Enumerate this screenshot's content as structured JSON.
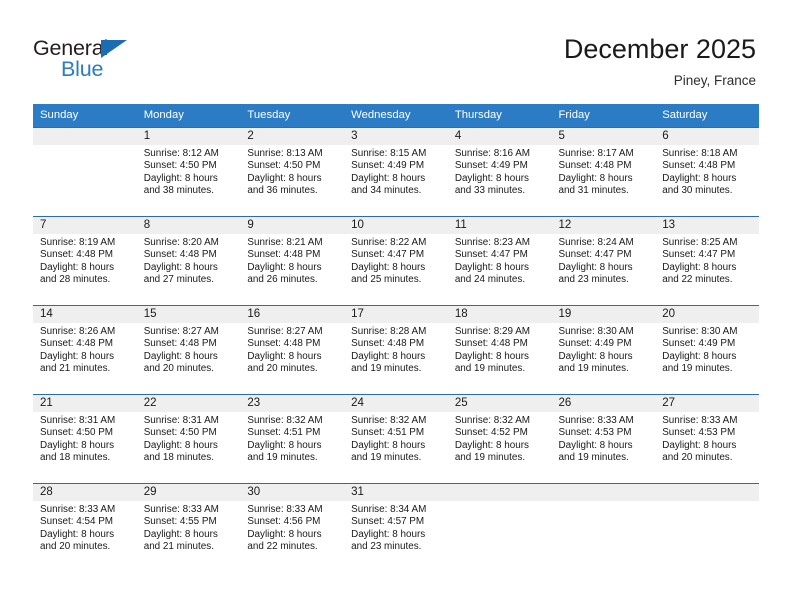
{
  "brand": {
    "name_part1": "General",
    "name_part2": "Blue",
    "triangle_icon": "triangle-icon",
    "accent_color": "#2b7cc4",
    "dark_color": "#231f20"
  },
  "header": {
    "month_title": "December 2025",
    "location": "Piney, France"
  },
  "calendar": {
    "header_bg": "#2b7cc4",
    "daynum_bg": "#efefef",
    "row_divider": "#2b6cb0",
    "weekdays": [
      "Sunday",
      "Monday",
      "Tuesday",
      "Wednesday",
      "Thursday",
      "Friday",
      "Saturday"
    ],
    "weeks": [
      [
        {
          "day": "",
          "lines": []
        },
        {
          "day": "1",
          "lines": [
            "Sunrise: 8:12 AM",
            "Sunset: 4:50 PM",
            "Daylight: 8 hours",
            "and 38 minutes."
          ]
        },
        {
          "day": "2",
          "lines": [
            "Sunrise: 8:13 AM",
            "Sunset: 4:50 PM",
            "Daylight: 8 hours",
            "and 36 minutes."
          ]
        },
        {
          "day": "3",
          "lines": [
            "Sunrise: 8:15 AM",
            "Sunset: 4:49 PM",
            "Daylight: 8 hours",
            "and 34 minutes."
          ]
        },
        {
          "day": "4",
          "lines": [
            "Sunrise: 8:16 AM",
            "Sunset: 4:49 PM",
            "Daylight: 8 hours",
            "and 33 minutes."
          ]
        },
        {
          "day": "5",
          "lines": [
            "Sunrise: 8:17 AM",
            "Sunset: 4:48 PM",
            "Daylight: 8 hours",
            "and 31 minutes."
          ]
        },
        {
          "day": "6",
          "lines": [
            "Sunrise: 8:18 AM",
            "Sunset: 4:48 PM",
            "Daylight: 8 hours",
            "and 30 minutes."
          ]
        }
      ],
      [
        {
          "day": "7",
          "lines": [
            "Sunrise: 8:19 AM",
            "Sunset: 4:48 PM",
            "Daylight: 8 hours",
            "and 28 minutes."
          ]
        },
        {
          "day": "8",
          "lines": [
            "Sunrise: 8:20 AM",
            "Sunset: 4:48 PM",
            "Daylight: 8 hours",
            "and 27 minutes."
          ]
        },
        {
          "day": "9",
          "lines": [
            "Sunrise: 8:21 AM",
            "Sunset: 4:48 PM",
            "Daylight: 8 hours",
            "and 26 minutes."
          ]
        },
        {
          "day": "10",
          "lines": [
            "Sunrise: 8:22 AM",
            "Sunset: 4:47 PM",
            "Daylight: 8 hours",
            "and 25 minutes."
          ]
        },
        {
          "day": "11",
          "lines": [
            "Sunrise: 8:23 AM",
            "Sunset: 4:47 PM",
            "Daylight: 8 hours",
            "and 24 minutes."
          ]
        },
        {
          "day": "12",
          "lines": [
            "Sunrise: 8:24 AM",
            "Sunset: 4:47 PM",
            "Daylight: 8 hours",
            "and 23 minutes."
          ]
        },
        {
          "day": "13",
          "lines": [
            "Sunrise: 8:25 AM",
            "Sunset: 4:47 PM",
            "Daylight: 8 hours",
            "and 22 minutes."
          ]
        }
      ],
      [
        {
          "day": "14",
          "lines": [
            "Sunrise: 8:26 AM",
            "Sunset: 4:48 PM",
            "Daylight: 8 hours",
            "and 21 minutes."
          ]
        },
        {
          "day": "15",
          "lines": [
            "Sunrise: 8:27 AM",
            "Sunset: 4:48 PM",
            "Daylight: 8 hours",
            "and 20 minutes."
          ]
        },
        {
          "day": "16",
          "lines": [
            "Sunrise: 8:27 AM",
            "Sunset: 4:48 PM",
            "Daylight: 8 hours",
            "and 20 minutes."
          ]
        },
        {
          "day": "17",
          "lines": [
            "Sunrise: 8:28 AM",
            "Sunset: 4:48 PM",
            "Daylight: 8 hours",
            "and 19 minutes."
          ]
        },
        {
          "day": "18",
          "lines": [
            "Sunrise: 8:29 AM",
            "Sunset: 4:48 PM",
            "Daylight: 8 hours",
            "and 19 minutes."
          ]
        },
        {
          "day": "19",
          "lines": [
            "Sunrise: 8:30 AM",
            "Sunset: 4:49 PM",
            "Daylight: 8 hours",
            "and 19 minutes."
          ]
        },
        {
          "day": "20",
          "lines": [
            "Sunrise: 8:30 AM",
            "Sunset: 4:49 PM",
            "Daylight: 8 hours",
            "and 19 minutes."
          ]
        }
      ],
      [
        {
          "day": "21",
          "lines": [
            "Sunrise: 8:31 AM",
            "Sunset: 4:50 PM",
            "Daylight: 8 hours",
            "and 18 minutes."
          ]
        },
        {
          "day": "22",
          "lines": [
            "Sunrise: 8:31 AM",
            "Sunset: 4:50 PM",
            "Daylight: 8 hours",
            "and 18 minutes."
          ]
        },
        {
          "day": "23",
          "lines": [
            "Sunrise: 8:32 AM",
            "Sunset: 4:51 PM",
            "Daylight: 8 hours",
            "and 19 minutes."
          ]
        },
        {
          "day": "24",
          "lines": [
            "Sunrise: 8:32 AM",
            "Sunset: 4:51 PM",
            "Daylight: 8 hours",
            "and 19 minutes."
          ]
        },
        {
          "day": "25",
          "lines": [
            "Sunrise: 8:32 AM",
            "Sunset: 4:52 PM",
            "Daylight: 8 hours",
            "and 19 minutes."
          ]
        },
        {
          "day": "26",
          "lines": [
            "Sunrise: 8:33 AM",
            "Sunset: 4:53 PM",
            "Daylight: 8 hours",
            "and 19 minutes."
          ]
        },
        {
          "day": "27",
          "lines": [
            "Sunrise: 8:33 AM",
            "Sunset: 4:53 PM",
            "Daylight: 8 hours",
            "and 20 minutes."
          ]
        }
      ],
      [
        {
          "day": "28",
          "lines": [
            "Sunrise: 8:33 AM",
            "Sunset: 4:54 PM",
            "Daylight: 8 hours",
            "and 20 minutes."
          ]
        },
        {
          "day": "29",
          "lines": [
            "Sunrise: 8:33 AM",
            "Sunset: 4:55 PM",
            "Daylight: 8 hours",
            "and 21 minutes."
          ]
        },
        {
          "day": "30",
          "lines": [
            "Sunrise: 8:33 AM",
            "Sunset: 4:56 PM",
            "Daylight: 8 hours",
            "and 22 minutes."
          ]
        },
        {
          "day": "31",
          "lines": [
            "Sunrise: 8:34 AM",
            "Sunset: 4:57 PM",
            "Daylight: 8 hours",
            "and 23 minutes."
          ]
        },
        {
          "day": "",
          "lines": []
        },
        {
          "day": "",
          "lines": []
        },
        {
          "day": "",
          "lines": []
        }
      ]
    ]
  }
}
